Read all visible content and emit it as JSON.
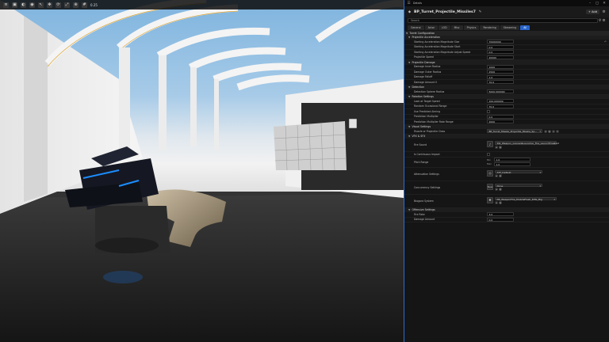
{
  "viewport": {
    "toolbar_value": "0.25"
  },
  "window": {
    "tab_title": "Details",
    "blueprint_name": "BP_Turret_Projectile_Missiles7",
    "add_label": "Add",
    "search_placeholder": "Search",
    "tabs": [
      {
        "label": "General",
        "active": false
      },
      {
        "label": "Actor",
        "active": false
      },
      {
        "label": "LOD",
        "active": false
      },
      {
        "label": "Misc",
        "active": false
      },
      {
        "label": "Physics",
        "active": false
      },
      {
        "label": "Rendering",
        "active": false
      },
      {
        "label": "Streaming",
        "active": false
      },
      {
        "label": "All",
        "active": true
      }
    ]
  },
  "details": {
    "turret_config_label": "Turret Configuration",
    "projectile_accel": {
      "title": "Projectile Acceleration",
      "rows": [
        {
          "label": "Starting Acceleration Magnitude Size",
          "value": "70000000"
        },
        {
          "label": "Starting Acceleration Magnitude Start",
          "value": "0.0"
        },
        {
          "label": "Starting Acceleration Magnitude Adjust Speed",
          "value": "0.0"
        },
        {
          "label": "Projectile Speed",
          "value": "20000"
        }
      ]
    },
    "projectile_damage": {
      "title": "Projectile Damage",
      "rows": [
        {
          "label": "Damage Inner Radius",
          "value": "1000"
        },
        {
          "label": "Damage Outer Radius",
          "value": "2500"
        },
        {
          "label": "Damage Falloff",
          "value": "1.0"
        },
        {
          "label": "Damage Amount 0",
          "value": "70.0"
        }
      ]
    },
    "detection": {
      "title": "Detection",
      "rows": [
        {
          "label": "Detection Sphere Radius",
          "value": "5000.000000"
        }
      ]
    },
    "rotation": {
      "title": "Rotation Settings",
      "rows": [
        {
          "label": "Look at Target Speed",
          "value": "100.000000"
        },
        {
          "label": "Random Occasional Range",
          "value": "70.0"
        },
        {
          "label": "Use Predicted Aiming",
          "value": ""
        },
        {
          "label": "Prediction Multiplier",
          "value": "0.0"
        },
        {
          "label": "Prediction Multiplier Rate Range",
          "value": "2000"
        }
      ]
    },
    "visual": {
      "title": "Visual Settings",
      "row_label": "Muzzle or Projectile Class",
      "value": "BP_Turret_Missile_Projectile_Missile_Sp..."
    },
    "vfx": {
      "title": "VFX & SFX",
      "fire_sound_label": "Fire Sound",
      "fire_sound_value": "SW_Weapon_GrenadeLauncher_Fire_LaunchFireLoad",
      "fire_count_label": "Is Continuous Impact",
      "pitch_range_label": "Pitch Range",
      "pitch_min_label": "Min",
      "pitch_min": "1.0",
      "pitch_max_label": "Max",
      "pitch_max": "1.0",
      "attenuation_label": "Attenuation Settings",
      "attenuation_value": "ATT_Default",
      "concurrency_label": "Concurrency Settings",
      "concurrency_value": "None",
      "concurrency_btn": "New",
      "niagara_label": "Niagara System",
      "niagara_value": "NS_WeaponFire_MuzzleFlash_Rifle_Big"
    },
    "offensive": {
      "title": "Offensive Settings",
      "rows": [
        {
          "label": "Fire Rate",
          "value": "3.0"
        },
        {
          "label": "Damage Amount",
          "value": "0.0"
        }
      ]
    }
  },
  "colors": {
    "accent": "#2864c8",
    "panel_bg": "#151515"
  }
}
